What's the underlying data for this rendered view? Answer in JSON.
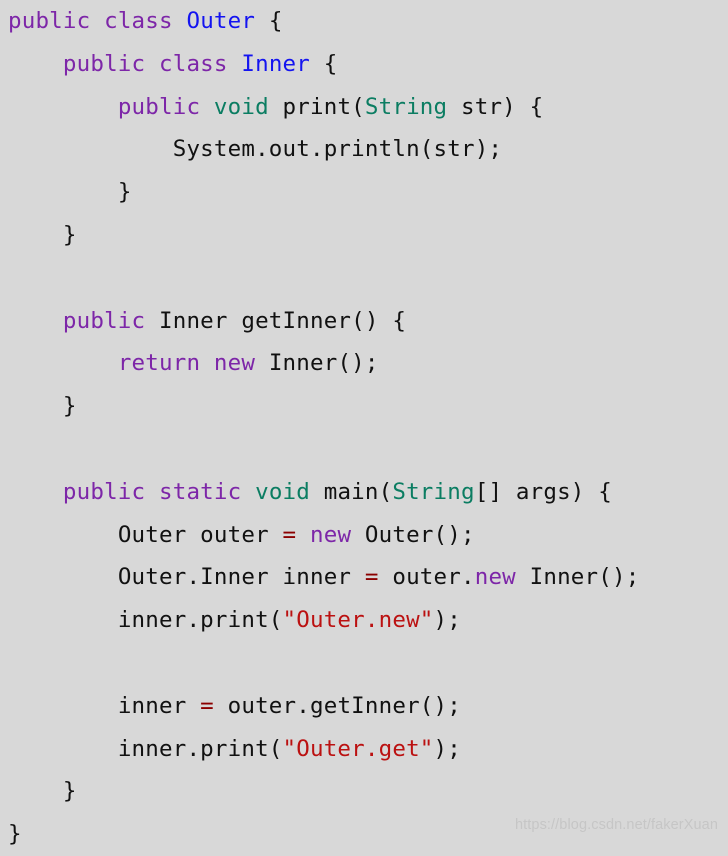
{
  "document": {
    "language": "java",
    "background_color": "#d8d8d8",
    "watermark": "https://blog.csdn.net/fakerXuan",
    "palette": {
      "keyword": "#7d26a8",
      "type": "#0b7d62",
      "classname": "#1414f0",
      "string": "#bb1111",
      "operator": "#8b0000",
      "plain": "#111111",
      "watermark": "#c6c6c6"
    },
    "plain_text": "public class Outer {\n    public class Inner {\n        public void print(String str) {\n            System.out.println(str);\n        }\n    }\n\n    public Inner getInner() {\n        return new Inner();\n    }\n\n    public static void main(String[] args) {\n        Outer outer = new Outer();\n        Outer.Inner inner = outer.new Inner();\n        inner.print(\"Outer.new\");\n\n        inner = outer.getInner();\n        inner.print(\"Outer.get\");\n    }\n}",
    "lines": [
      {
        "indent": 0,
        "tokens": [
          {
            "t": "public",
            "c": "keyword"
          },
          {
            "t": " ",
            "c": "plain"
          },
          {
            "t": "class",
            "c": "keyword"
          },
          {
            "t": " ",
            "c": "plain"
          },
          {
            "t": "Outer",
            "c": "classname"
          },
          {
            "t": " {",
            "c": "plain"
          }
        ]
      },
      {
        "indent": 1,
        "tokens": [
          {
            "t": "public",
            "c": "keyword"
          },
          {
            "t": " ",
            "c": "plain"
          },
          {
            "t": "class",
            "c": "keyword"
          },
          {
            "t": " ",
            "c": "plain"
          },
          {
            "t": "Inner",
            "c": "classname"
          },
          {
            "t": " {",
            "c": "plain"
          }
        ]
      },
      {
        "indent": 2,
        "tokens": [
          {
            "t": "public",
            "c": "keyword"
          },
          {
            "t": " ",
            "c": "plain"
          },
          {
            "t": "void",
            "c": "type"
          },
          {
            "t": " print(",
            "c": "plain"
          },
          {
            "t": "String",
            "c": "type"
          },
          {
            "t": " str) {",
            "c": "plain"
          }
        ]
      },
      {
        "indent": 3,
        "tokens": [
          {
            "t": "System.out.println(str);",
            "c": "plain"
          }
        ]
      },
      {
        "indent": 2,
        "tokens": [
          {
            "t": "}",
            "c": "plain"
          }
        ]
      },
      {
        "indent": 1,
        "tokens": [
          {
            "t": "}",
            "c": "plain"
          }
        ]
      },
      {
        "indent": 0,
        "tokens": []
      },
      {
        "indent": 1,
        "tokens": [
          {
            "t": "public",
            "c": "keyword"
          },
          {
            "t": " Inner getInner() {",
            "c": "plain"
          }
        ]
      },
      {
        "indent": 2,
        "tokens": [
          {
            "t": "return",
            "c": "keyword"
          },
          {
            "t": " ",
            "c": "plain"
          },
          {
            "t": "new",
            "c": "keyword"
          },
          {
            "t": " Inner();",
            "c": "plain"
          }
        ]
      },
      {
        "indent": 1,
        "tokens": [
          {
            "t": "}",
            "c": "plain"
          }
        ]
      },
      {
        "indent": 0,
        "tokens": []
      },
      {
        "indent": 1,
        "tokens": [
          {
            "t": "public",
            "c": "keyword"
          },
          {
            "t": " ",
            "c": "plain"
          },
          {
            "t": "static",
            "c": "keyword"
          },
          {
            "t": " ",
            "c": "plain"
          },
          {
            "t": "void",
            "c": "type"
          },
          {
            "t": " main(",
            "c": "plain"
          },
          {
            "t": "String",
            "c": "type"
          },
          {
            "t": "[] args) {",
            "c": "plain"
          }
        ]
      },
      {
        "indent": 2,
        "tokens": [
          {
            "t": "Outer outer ",
            "c": "plain"
          },
          {
            "t": "=",
            "c": "operator"
          },
          {
            "t": " ",
            "c": "plain"
          },
          {
            "t": "new",
            "c": "keyword"
          },
          {
            "t": " Outer();",
            "c": "plain"
          }
        ]
      },
      {
        "indent": 2,
        "tokens": [
          {
            "t": "Outer.Inner inner ",
            "c": "plain"
          },
          {
            "t": "=",
            "c": "operator"
          },
          {
            "t": " outer.",
            "c": "plain"
          },
          {
            "t": "new",
            "c": "keyword"
          },
          {
            "t": " Inner();",
            "c": "plain"
          }
        ]
      },
      {
        "indent": 2,
        "tokens": [
          {
            "t": "inner.print(",
            "c": "plain"
          },
          {
            "t": "\"Outer.new\"",
            "c": "string"
          },
          {
            "t": ");",
            "c": "plain"
          }
        ]
      },
      {
        "indent": 0,
        "tokens": []
      },
      {
        "indent": 2,
        "tokens": [
          {
            "t": "inner ",
            "c": "plain"
          },
          {
            "t": "=",
            "c": "operator"
          },
          {
            "t": " outer.getInner();",
            "c": "plain"
          }
        ]
      },
      {
        "indent": 2,
        "tokens": [
          {
            "t": "inner.print(",
            "c": "plain"
          },
          {
            "t": "\"Outer.get\"",
            "c": "string"
          },
          {
            "t": ");",
            "c": "plain"
          }
        ]
      },
      {
        "indent": 1,
        "tokens": [
          {
            "t": "}",
            "c": "plain"
          }
        ]
      },
      {
        "indent": 0,
        "tokens": [
          {
            "t": "}",
            "c": "plain"
          }
        ]
      }
    ]
  }
}
